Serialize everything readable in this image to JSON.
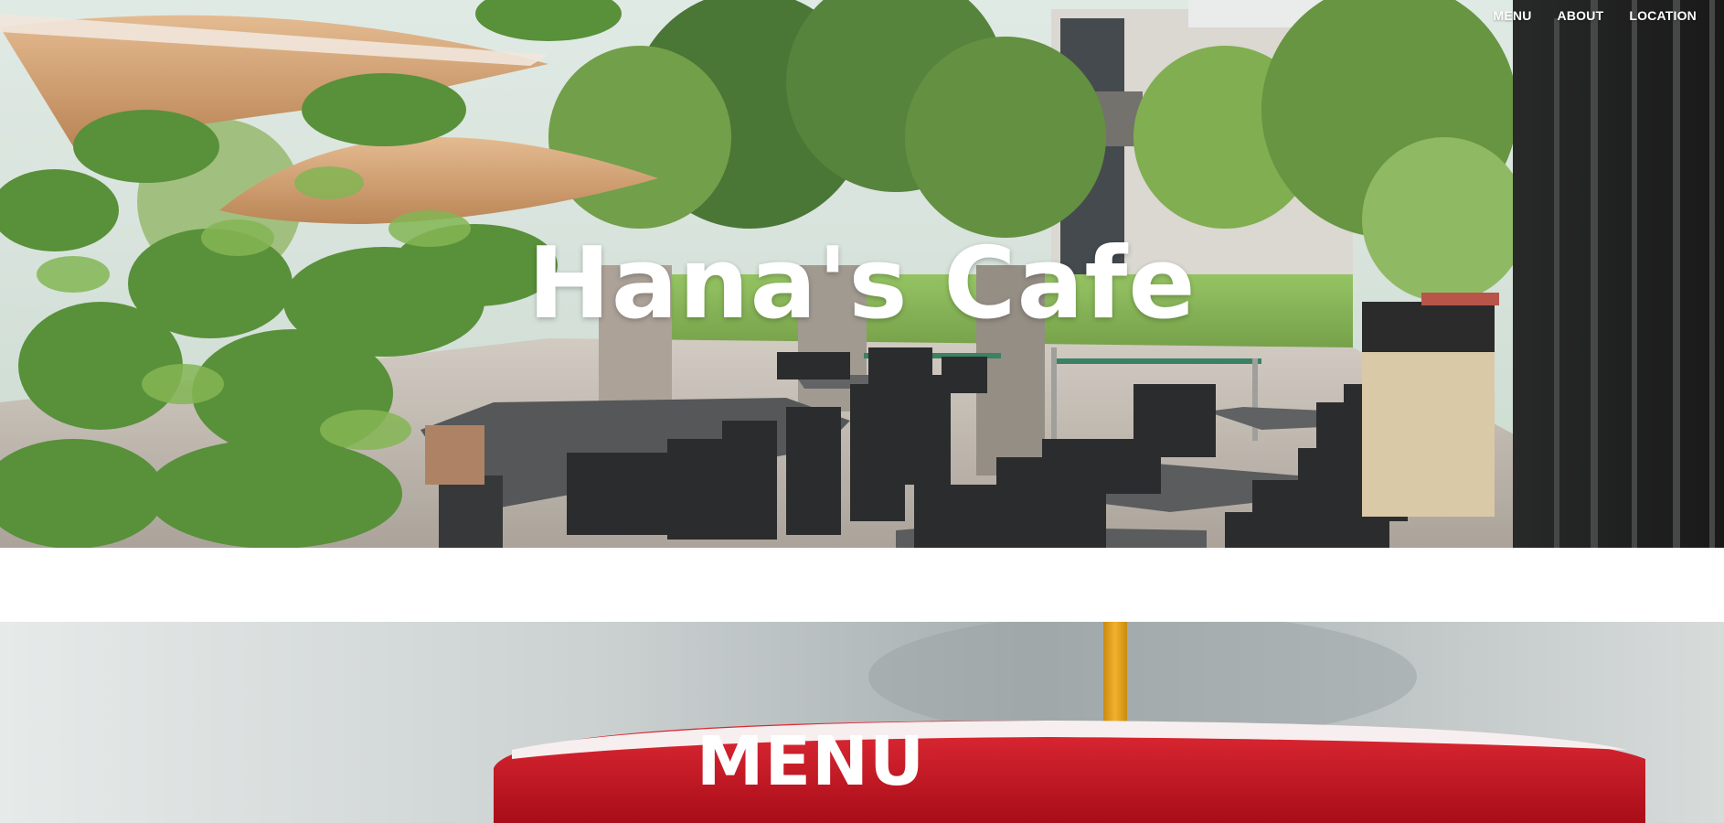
{
  "nav": {
    "items": [
      {
        "label": "MENU"
      },
      {
        "label": "ABOUT"
      },
      {
        "label": "LOCATION"
      }
    ]
  },
  "hero": {
    "title": "Hana's Cafe",
    "image_icon": "cafe-patio-photo"
  },
  "menu_section": {
    "title": "MENU",
    "image_icon": "coffee-cup-photo"
  },
  "colors": {
    "nav_text": "#ffffff",
    "title_text": "#ffffff",
    "cup_red": "#c8101e",
    "page_bg": "#ffffff"
  }
}
